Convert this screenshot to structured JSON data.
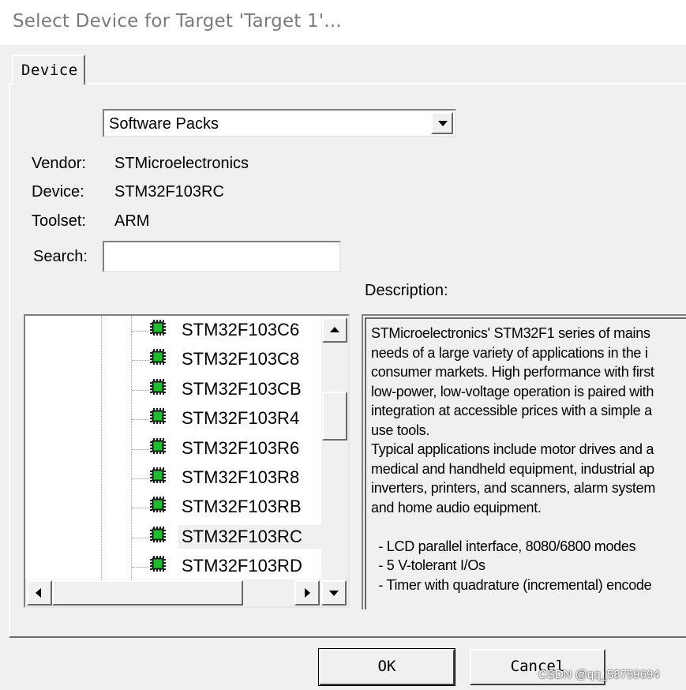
{
  "window": {
    "title": "Select Device for Target 'Target 1'..."
  },
  "tabs": [
    {
      "label": "Device"
    }
  ],
  "source_select": {
    "value": "Software Packs"
  },
  "info": {
    "vendor_label": "Vendor:",
    "vendor_value": "STMicroelectronics",
    "device_label": "Device:",
    "device_value": "STM32F103RC",
    "toolset_label": "Toolset:",
    "toolset_value": "ARM",
    "search_label": "Search:",
    "search_value": ""
  },
  "device_tree": {
    "items": [
      {
        "name": "STM32F103C6"
      },
      {
        "name": "STM32F103C8"
      },
      {
        "name": "STM32F103CB"
      },
      {
        "name": "STM32F103R4"
      },
      {
        "name": "STM32F103R6"
      },
      {
        "name": "STM32F103R8"
      },
      {
        "name": "STM32F103RB"
      },
      {
        "name": "STM32F103RC"
      },
      {
        "name": "STM32F103RD"
      }
    ],
    "selected": "STM32F103RC"
  },
  "description": {
    "label": "Description:",
    "text": "STMicroelectronics' STM32F1 series of mains\nneeds of a large variety of applications in the i\nconsumer markets. High performance with first\nlow-power, low-voltage operation is paired with\nintegration at accessible prices with a simple a\nuse tools.\nTypical applications include motor drives and a\nmedical and handheld equipment, industrial ap\ninverters, printers, and scanners, alarm system\nand home audio equipment.\n\n  - LCD parallel interface, 8080/6800 modes\n  - 5 V-tolerant I/Os\n  - Timer with quadrature (incremental) encode"
  },
  "buttons": {
    "ok": "OK",
    "cancel": "Cancel"
  },
  "watermark": "CSDN @qq_58759694",
  "colors": {
    "chip_green": "#19c02a",
    "chip_dark": "#1a1a1a",
    "selection": "#f0f0f0"
  }
}
